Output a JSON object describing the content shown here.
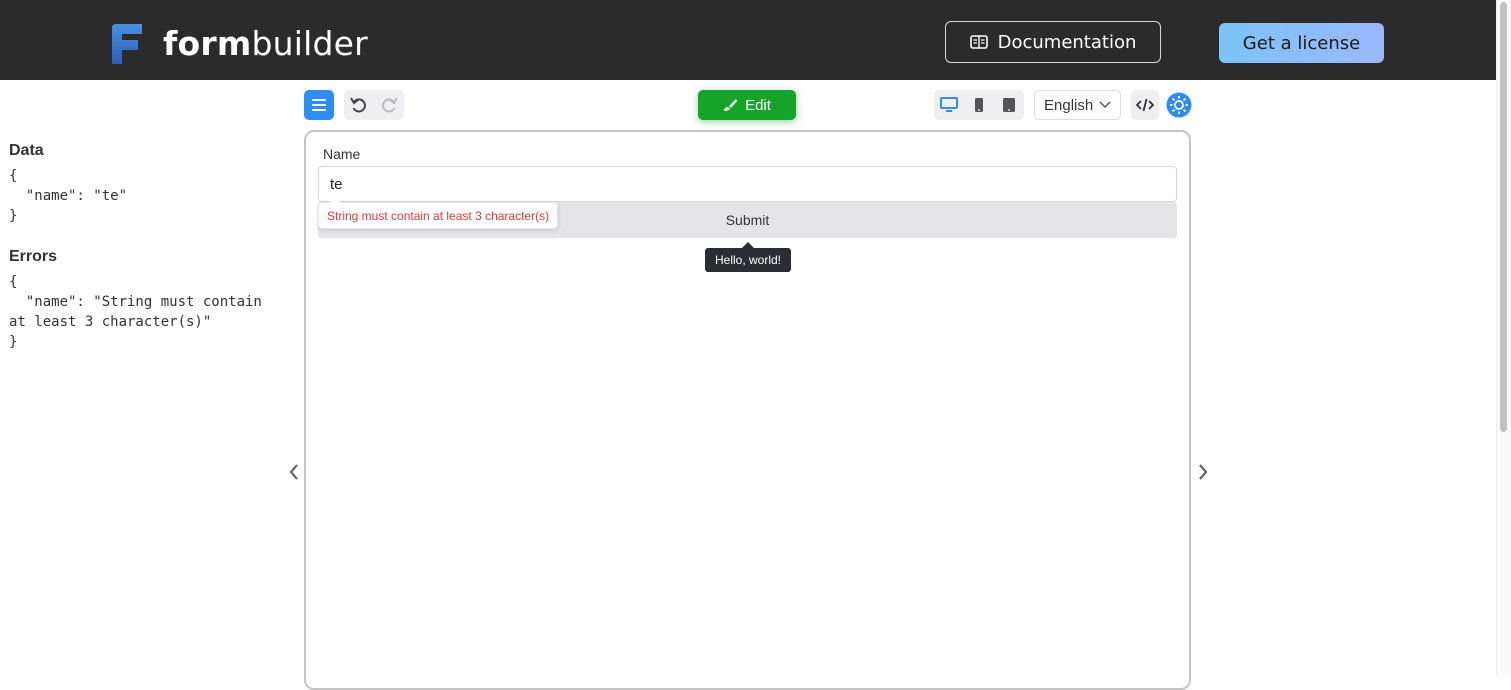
{
  "header": {
    "brand_bold": "form",
    "brand_light": "builder",
    "docs_label": "Documentation",
    "license_label": "Get a license"
  },
  "left_panel": {
    "data_title": "Data",
    "data_json": "{\n  \"name\": \"te\"\n}",
    "errors_title": "Errors",
    "errors_json": "{\n  \"name\": \"String must contain\nat least 3 character(s)\"\n}"
  },
  "toolbar": {
    "edit_label": "Edit",
    "language": "English"
  },
  "form": {
    "name_label": "Name",
    "name_value": "te",
    "submit_label": "Submit",
    "error_message": "String must contain at least 3 character(s)",
    "tooltip": "Hello, world!"
  },
  "colors": {
    "accent": "#2f8cf0",
    "edit_green": "#16a32a",
    "error_red": "#e03a3a",
    "header_bg": "#2b2b2b"
  },
  "icons": [
    "logo-icon",
    "book-icon",
    "menu-icon",
    "undo-icon",
    "redo-icon",
    "brush-icon",
    "desktop-icon",
    "tablet-icon",
    "phone-icon",
    "chevron-down-icon",
    "code-icon",
    "settings-icon",
    "chevron-left-icon",
    "chevron-right-icon"
  ]
}
